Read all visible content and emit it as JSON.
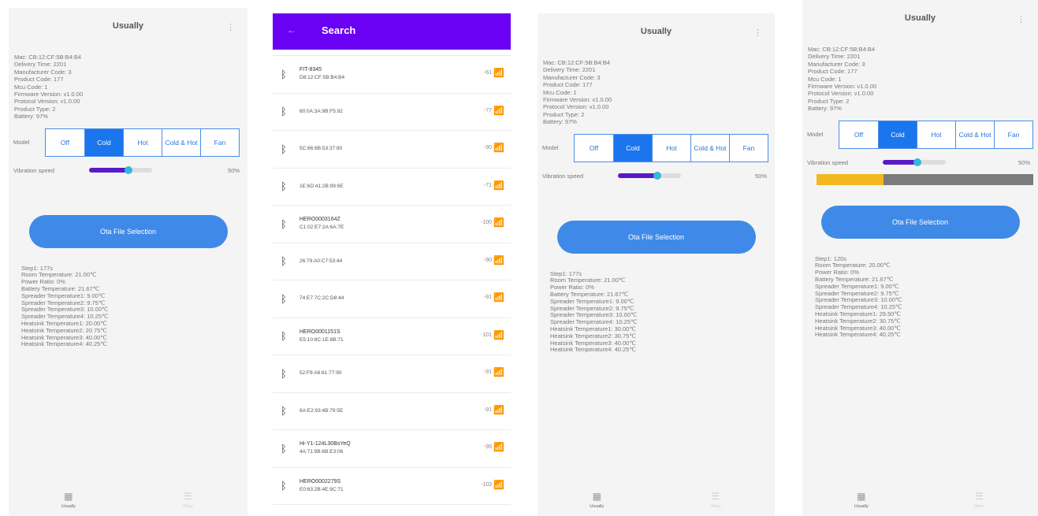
{
  "screen1": {
    "title": "Usually",
    "menu_icon": "kebab-icon",
    "info": [
      "Mac: CB:12:CF:5B:B4:B4",
      "Delivery Time: 2201",
      "Manufacturer Code: 3",
      "Product Code: 177",
      "Mcu Code: 1",
      "Firmware Version: v1.0.00",
      "Protocol Version: v1.0.00",
      "Product Type: 2",
      "Battery: 97%"
    ],
    "mode_label": "Model",
    "modes": [
      "Off",
      "Cold",
      "Hot",
      "Cold & Hot",
      "Fan"
    ],
    "active_mode": "Cold",
    "speed_label": "Vibration speed",
    "speed_value": 0.62,
    "speed_pct": "50%",
    "cta": "Ota File Selection",
    "stats": [
      "Step1: 177s",
      "Room Temperature: 21.00℃",
      "Power Ratio: 0%",
      "Battery Temperature: 21.67℃",
      "Spreader Temperature1: 9.00℃",
      "Spreader Temperature2: 9.75℃",
      "Spreader Temperature3: 10.00℃",
      "Spreader Temperature4: 10.25℃",
      "Heatsink Temperature1: 20.00℃",
      "Heatsink Temperature2: 20.75℃",
      "Heatsink Temperature3: 40.00℃",
      "Heatsink Temperature4: 40.25℃"
    ],
    "nav": [
      {
        "label": "Usually",
        "icon": "grid-icon"
      },
      {
        "label": "Other",
        "icon": "list-icon"
      }
    ]
  },
  "screen2": {
    "title": "Search",
    "back_icon": "arrow-left-icon",
    "devices": [
      {
        "name": "FIT-8345",
        "mac": "D8:12:CF:5B:B4:B4",
        "rssi": "-61"
      },
      {
        "name": "",
        "mac": "60:0A:3A:9B:F5:92",
        "rssi": "-77"
      },
      {
        "name": "",
        "mac": "5C:66:6B:53:37:80",
        "rssi": "-90"
      },
      {
        "name": "",
        "mac": "1E:6D:41:2B:99:6E",
        "rssi": "-71"
      },
      {
        "name": "HERO0003164Z",
        "mac": "C1:02:E7:2A:6A:7E",
        "rssi": "-100"
      },
      {
        "name": "",
        "mac": "26:79:A0:C7:53:44",
        "rssi": "-90"
      },
      {
        "name": "",
        "mac": "74:E7:7C:2C:D8:44",
        "rssi": "-91"
      },
      {
        "name": "HERO0001151S",
        "mac": "E5:10:8C:1E:8B:71",
        "rssi": "-101"
      },
      {
        "name": "",
        "mac": "52:F9:A6:61:77:90",
        "rssi": "-91"
      },
      {
        "name": "",
        "mac": "6A:E2:93:4B:79:5E",
        "rssi": "-91"
      },
      {
        "name": "Hi-Y1-124L30BsYeQ",
        "mac": "4A:71:9B:6B:E3:06",
        "rssi": "-95"
      },
      {
        "name": "HERO0002279S",
        "mac": "E0:63:2B:4E:9C:71",
        "rssi": "-103"
      }
    ]
  },
  "screen3": {
    "title": "Usually",
    "menu_icon": "kebab-icon",
    "info": [
      "Mac: CB:12:CF:5B:B4:B4",
      "Delivery Time: 2201",
      "Manufacturer Code: 3",
      "Product Code: 177",
      "Mcu Code: 1",
      "Firmware Version: v1.0.00",
      "Protocol Version: v1.0.00",
      "Product Type: 2",
      "Battery: 97%"
    ],
    "mode_label": "Model",
    "modes": [
      "Off",
      "Cold",
      "Hot",
      "Cold & Hot",
      "Fan"
    ],
    "active_mode": "Cold",
    "speed_label": "Vibration speed",
    "speed_value": 0.62,
    "speed_pct": "50%",
    "cta": "Ota File Selection",
    "stats": [
      "Step1: 177s",
      "Room Temperature: 21.00℃",
      "Power Ratio: 0%",
      "Battery Temperature: 21.67℃",
      "Spreader Temperature1: 9.00℃",
      "Spreader Temperature2: 9.75℃",
      "Spreader Temperature3: 10.00℃",
      "Spreader Temperature4: 10.25℃",
      "Heatsink Temperature1: 30.00℃",
      "Heatsink Temperature2: 30.75℃",
      "Heatsink Temperature3: 40.00℃",
      "Heatsink Temperature4: 40.25℃"
    ],
    "nav": [
      {
        "label": "Usually",
        "icon": "grid-icon"
      },
      {
        "label": "Other",
        "icon": "list-icon"
      }
    ]
  },
  "screen4": {
    "title": "Usually",
    "menu_icon": "kebab-icon",
    "info": [
      "Mac: CB:12:CF:5B:B4:B4",
      "Delivery Time: 2201",
      "Manufacturer Code: 3",
      "Product Code: 177",
      "Mcu Code: 1",
      "Firmware Version: v1.0.00",
      "Protocol Version: v1.0.00",
      "Product Type: 2",
      "Battery: 97%"
    ],
    "mode_label": "Model",
    "modes": [
      "Off",
      "Cold",
      "Hot",
      "Cold & Hot",
      "Fan"
    ],
    "active_mode": "Cold",
    "speed_label": "Vibration speed",
    "speed_value": 0.55,
    "speed_pct": "50%",
    "progress_value": 0.31,
    "cta": "Ota File Selection",
    "stats": [
      "Step1: 120s",
      "Room Temperature: 20.00℃",
      "Power Ratio: 0%",
      "Battery Temperature: 21.67℃",
      "Spreader Temperature1: 9.00℃",
      "Spreader Temperature2: 9.75℃",
      "Spreader Temperature3: 10.00℃",
      "Spreader Temperature4: 10.25℃",
      "Heatsink Temperature1: 29.50℃",
      "Heatsink Temperature2: 30.75℃",
      "Heatsink Temperature3: 40.00℃",
      "Heatsink Temperature4: 40.25℃"
    ],
    "nav": [
      {
        "label": "Usually",
        "icon": "grid-icon"
      },
      {
        "label": "Other",
        "icon": "list-icon"
      }
    ]
  },
  "colors": {
    "accent_blue": "#1b76ee",
    "search_purple": "#6a00f4",
    "speed_purple": "#5b1ac9",
    "speed_thumb": "#35b8d8",
    "progress_yellow": "#f2b81d",
    "progress_gray": "#7b7b7b",
    "cta_blue": "#3f8ae8"
  }
}
